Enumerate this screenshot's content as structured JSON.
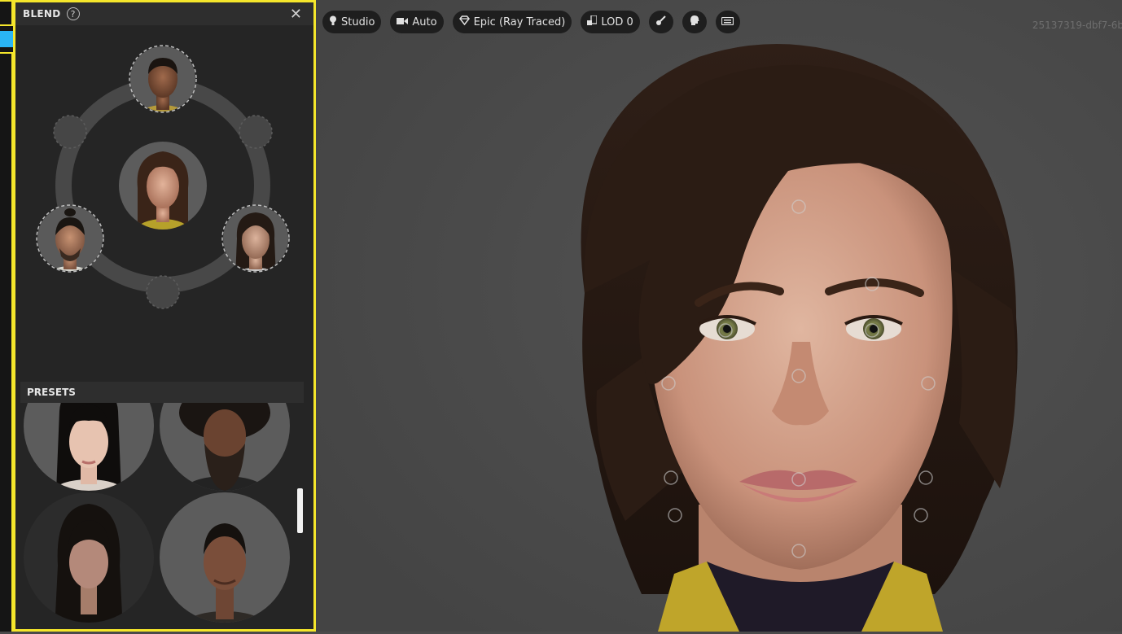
{
  "panel": {
    "title": "BLEND",
    "help_icon": "?",
    "close_icon": "✕"
  },
  "presets": {
    "title": "PRESETS"
  },
  "toolbar": {
    "lighting_label": "Studio",
    "camera_label": "Auto",
    "quality_label": "Epic (Ray Traced)",
    "lod_label": "LOD 0"
  },
  "viewport": {
    "session_id": "25137319-dbf7-6b"
  },
  "icons": {
    "lighting": "lightbulb-icon",
    "camera": "video-camera-icon",
    "quality": "diamond-icon",
    "lod": "lod-icon",
    "tool1": "brush-icon",
    "tool2": "head-icon",
    "tool3": "keyboard-icon"
  },
  "colors": {
    "highlight": "#f5e62b",
    "accent_tab": "#2ab5f5",
    "panel_bg": "#252525",
    "viewport_bg": "#4b4b4b"
  }
}
